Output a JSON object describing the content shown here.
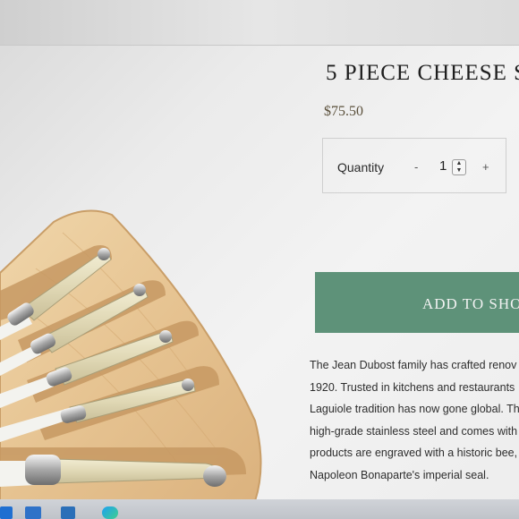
{
  "product": {
    "title": "5 PIECE CHEESE S",
    "price": "$75.50"
  },
  "quantity": {
    "label": "Quantity",
    "minus": "-",
    "value": "1",
    "plus": "+"
  },
  "actions": {
    "add_to_cart": "ADD TO SHO"
  },
  "description": {
    "lines": [
      "The Jean Dubost family has crafted renov",
      "1920. Trusted in kitchens and restaurants",
      "Laguiole tradition has now gone global. Th",
      "high-grade stainless steel and comes with",
      "products are engraved with a historic bee,",
      "Napoleon Bonaparte's imperial seal."
    ]
  },
  "colors": {
    "button": "#5e9279",
    "board": "#e7c89a",
    "handle": "#e3dcbc"
  },
  "taskbar": {
    "icons": [
      "windows-start-icon",
      "mail-icon",
      "calculator-icon",
      "edge-icon"
    ]
  }
}
